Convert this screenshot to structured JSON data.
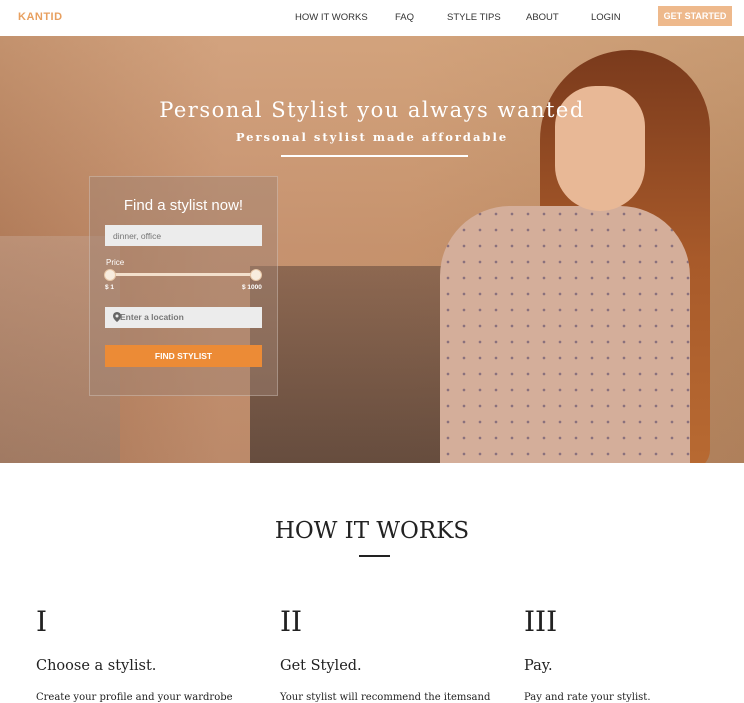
{
  "nav": {
    "logo": "KANTID",
    "links": [
      "HOW IT WORKS",
      "FAQ",
      "STYLE TIPS",
      "ABOUT",
      "LOGIN"
    ],
    "cta": "GET STARTED"
  },
  "hero": {
    "title": "Personal Stylist you always wanted",
    "subtitle": "Personal stylist made affordable"
  },
  "search": {
    "title": "Find a stylist now!",
    "occasion_placeholder": "dinner, office",
    "price_label": "Price",
    "price_min": "$ 1",
    "price_max": "$ 1000",
    "price_range_fraction": [
      0.0,
      1.0
    ],
    "location_placeholder": "Enter a location",
    "button": "FIND STYLIST"
  },
  "how_it_works": {
    "title": "HOW IT WORKS",
    "steps": [
      {
        "num": "I",
        "title": "Choose a stylist.",
        "text": "Create your profile and your wardrobe"
      },
      {
        "num": "II",
        "title": "Get Styled.",
        "text": "Your stylist will recommend the itemsand"
      },
      {
        "num": "III",
        "title": "Pay.",
        "text": "Pay and rate your stylist."
      }
    ]
  },
  "colors": {
    "accent": "#ec8b36",
    "logo": "#e8a060",
    "cta_bg": "#eeb98c"
  }
}
